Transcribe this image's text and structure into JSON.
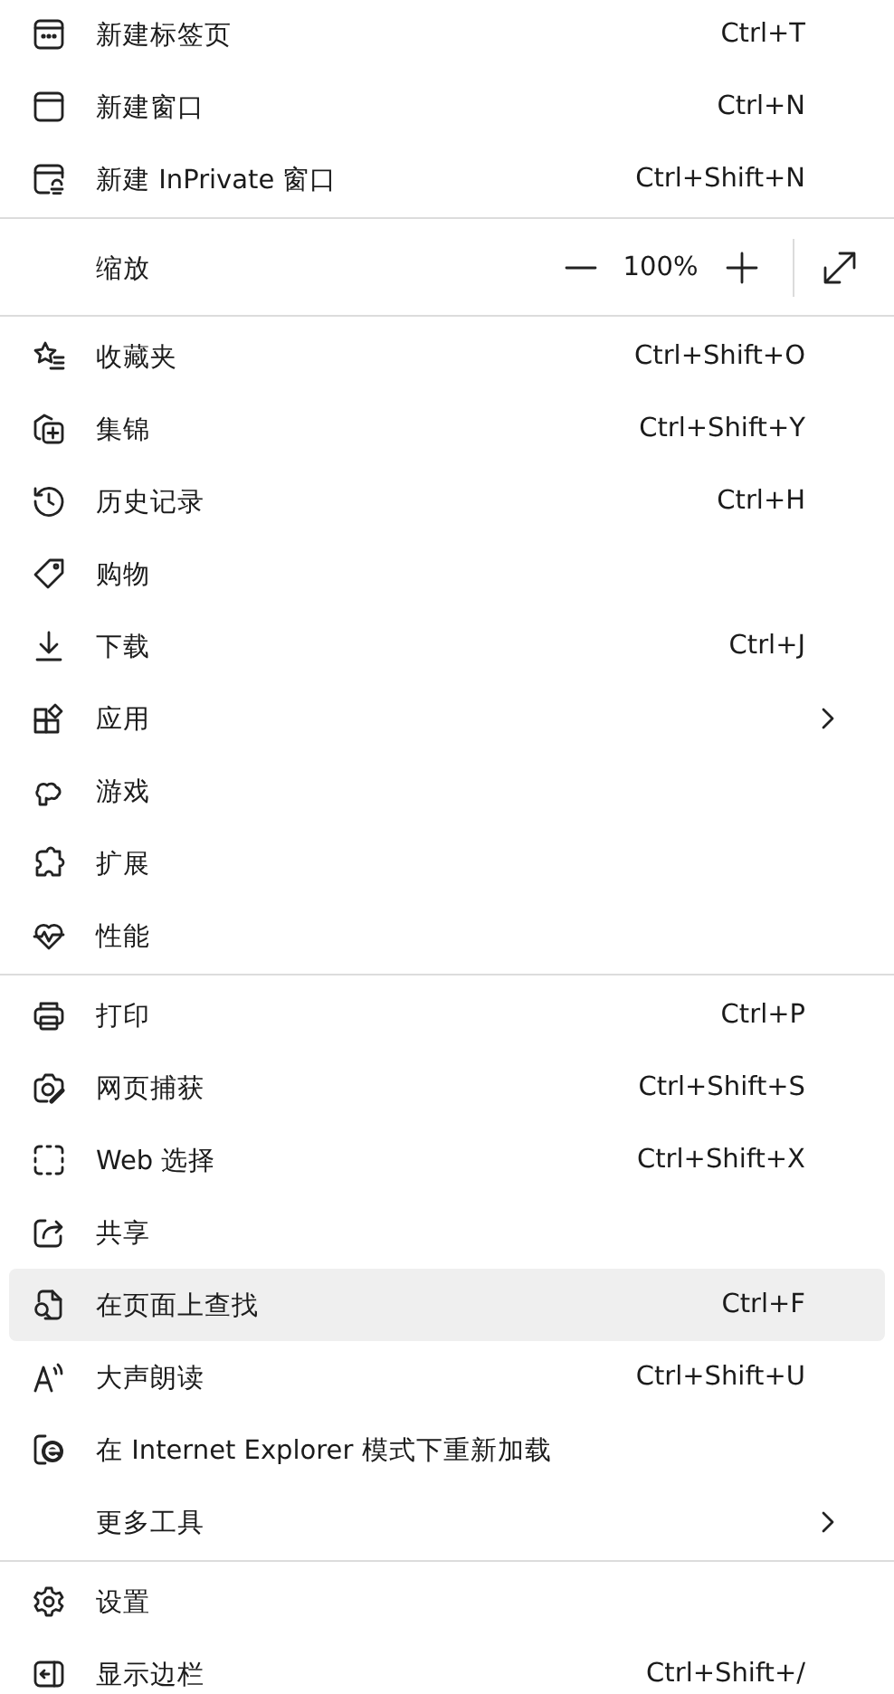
{
  "sections": [
    {
      "items": [
        {
          "kind": "item",
          "label": "新建标签页",
          "shortcut": "Ctrl+T",
          "submenu": false,
          "highlighted": false
        },
        {
          "kind": "item",
          "label": "新建窗口",
          "shortcut": "Ctrl+N",
          "submenu": false,
          "highlighted": false
        },
        {
          "kind": "item",
          "label": "新建 InPrivate 窗口",
          "shortcut": "Ctrl+Shift+N",
          "submenu": false,
          "highlighted": false
        }
      ]
    },
    {
      "items": [
        {
          "kind": "zoom",
          "label": "缩放",
          "value": "100%",
          "submenu": false,
          "highlighted": false
        }
      ]
    },
    {
      "items": [
        {
          "kind": "item",
          "label": "收藏夹",
          "shortcut": "Ctrl+Shift+O",
          "submenu": false,
          "highlighted": false
        },
        {
          "kind": "item",
          "label": "集锦",
          "shortcut": "Ctrl+Shift+Y",
          "submenu": false,
          "highlighted": false
        },
        {
          "kind": "item",
          "label": "历史记录",
          "shortcut": "Ctrl+H",
          "submenu": false,
          "highlighted": false
        },
        {
          "kind": "item",
          "label": "购物",
          "submenu": false,
          "highlighted": false
        },
        {
          "kind": "item",
          "label": "下载",
          "shortcut": "Ctrl+J",
          "submenu": false,
          "highlighted": false
        },
        {
          "kind": "item",
          "label": "应用",
          "submenu": true,
          "highlighted": false
        },
        {
          "kind": "item",
          "label": "游戏",
          "submenu": false,
          "highlighted": false
        },
        {
          "kind": "item",
          "label": "扩展",
          "submenu": false,
          "highlighted": false
        },
        {
          "kind": "item",
          "label": "性能",
          "submenu": false,
          "highlighted": false
        }
      ]
    },
    {
      "items": [
        {
          "kind": "item",
          "label": "打印",
          "shortcut": "Ctrl+P",
          "submenu": false,
          "highlighted": false
        },
        {
          "kind": "item",
          "label": "网页捕获",
          "shortcut": "Ctrl+Shift+S",
          "submenu": false,
          "highlighted": false
        },
        {
          "kind": "item",
          "label": "Web 选择",
          "shortcut": "Ctrl+Shift+X",
          "submenu": false,
          "highlighted": false
        },
        {
          "kind": "item",
          "label": "共享",
          "submenu": false,
          "highlighted": false
        },
        {
          "kind": "item",
          "label": "在页面上查找",
          "shortcut": "Ctrl+F",
          "submenu": false,
          "highlighted": true
        },
        {
          "kind": "item",
          "label": "大声朗读",
          "shortcut": "Ctrl+Shift+U",
          "submenu": false,
          "highlighted": false
        },
        {
          "kind": "item",
          "label": "在 Internet Explorer 模式下重新加载",
          "submenu": false,
          "highlighted": false
        },
        {
          "kind": "item",
          "label": "更多工具",
          "submenu": true,
          "highlighted": false
        }
      ]
    },
    {
      "items": [
        {
          "kind": "item",
          "label": "设置",
          "submenu": false,
          "highlighted": false
        },
        {
          "kind": "item",
          "label": "显示边栏",
          "shortcut": "Ctrl+Shift+/",
          "submenu": false,
          "highlighted": false
        }
      ]
    }
  ]
}
